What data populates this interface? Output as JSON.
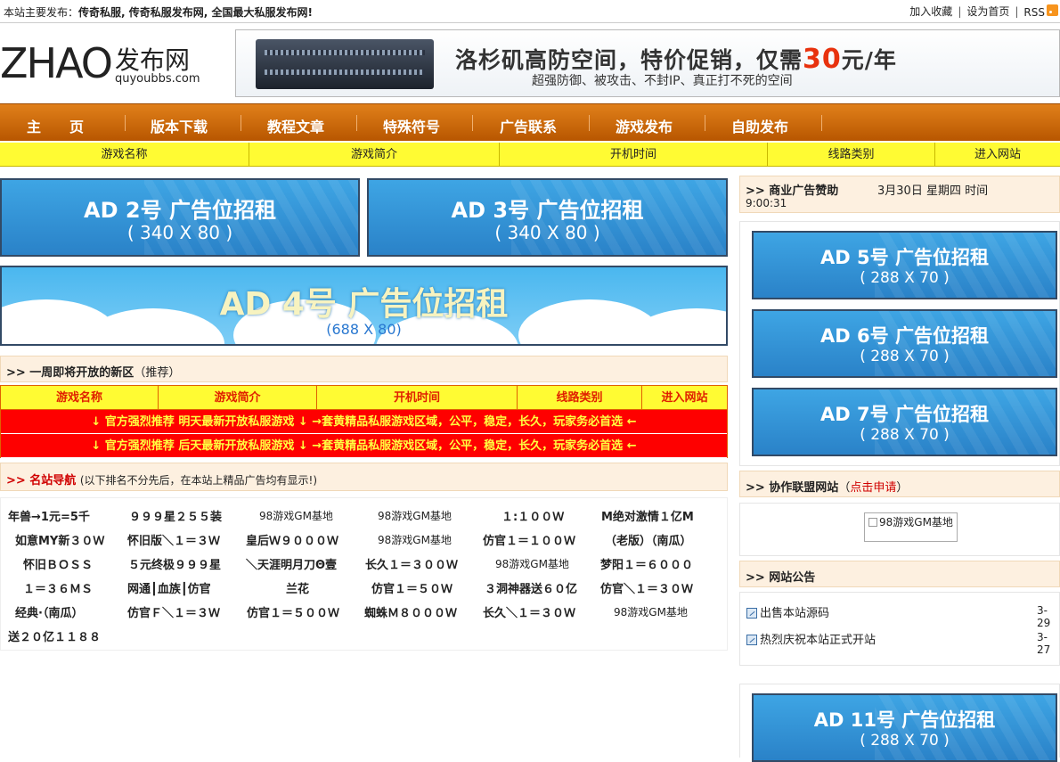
{
  "topbar": {
    "left_prefix": "本站主要发布：",
    "left_text": "传奇私服, 传奇私服发布网, 全国最大私服发布网!",
    "links": [
      "加入收藏",
      "设为首页",
      "RSS"
    ]
  },
  "logo": {
    "big": "ZHAO",
    "cn": "发布网",
    "url": "quyoubbs.com"
  },
  "banner": {
    "line1_a": "洛杉矶高防空间，特价促销，仅需",
    "line1_num": "30",
    "line1_b": "元/年",
    "line2": "超强防御、被攻击、不封IP、真正打不死的空间"
  },
  "nav": [
    "主　　页",
    "版本下载",
    "教程文章",
    "特殊符号",
    "广告联系",
    "游戏发布",
    "自助发布"
  ],
  "subnav": [
    "游戏名称",
    "游戏简介",
    "开机时间",
    "线路类别",
    "进入网站"
  ],
  "ads": {
    "ad2": {
      "l1": "AD 2号 广告位招租",
      "l2": "( 340 X 80 )"
    },
    "ad3": {
      "l1": "AD 3号 广告位招租",
      "l2": "( 340 X 80 )"
    },
    "ad4": {
      "l1": "AD 4号 广告位招租",
      "l2": "(688 X 80)"
    },
    "ad5": {
      "l1": "AD 5号 广告位招租",
      "l2": "( 288 X 70 )"
    },
    "ad6": {
      "l1": "AD 6号 广告位招租",
      "l2": "( 288 X 70 )"
    },
    "ad7": {
      "l1": "AD 7号 广告位招租",
      "l2": "( 288 X 70 )"
    },
    "ad11": {
      "l1": "AD 11号 广告位招租",
      "l2": "( 288 X 70 )"
    }
  },
  "week_section": {
    "title": ">> 一周即将开放的新区",
    "suffix": "（推荐）"
  },
  "table": {
    "headers": [
      "游戏名称",
      "游戏简介",
      "开机时间",
      "线路类别",
      "进入网站"
    ],
    "row1": "↓ 官方强烈推荐 明天最新开放私服游戏 ↓ →套黄精品私服游戏区域，公平，稳定，长久，玩家务必首选 ←",
    "row2": "↓ 官方强烈推荐 后天最新开放私服游戏 ↓ →套黄精品私服游戏区域，公平，稳定，长久，玩家务必首选 ←"
  },
  "sites_section": {
    "title": ">> 名站导航",
    "note": "(以下排名不分先后，在本站上精品广告均有显示!)"
  },
  "sites": [
    [
      "年兽→1元=5千",
      "９９９星２５５装",
      "98游戏GM基地",
      "98游戏GM基地",
      "１:１００Ｗ",
      "M绝对激情１亿M"
    ],
    [
      "如意MY新３０Ｗ",
      "怀旧版＼１＝３Ｗ",
      "皇后Ｗ９０００Ｗ",
      "98游戏GM基地",
      "仿官１＝１００Ｗ",
      "（老版）（南瓜）"
    ],
    [
      "怀旧ＢＯＳＳ",
      "５元终极９９９星",
      "＼天涯明月刀Θ壹",
      "长久１＝３００Ｗ",
      "98游戏GM基地",
      "梦阳１＝６０００"
    ],
    [
      "１＝３６ＭＳ",
      "网通┃血族┃仿官",
      "兰花",
      "仿官１＝５０Ｗ",
      "３洞神器送６０亿",
      "仿官＼１＝３０Ｗ"
    ],
    [
      "经典·（南瓜）",
      "仿官Ｆ＼１＝３Ｗ",
      "仿官１＝５００Ｗ",
      "蜘蛛Ｍ８０００Ｗ",
      "长久＼１＝３０Ｗ",
      "98游戏GM基地"
    ],
    [
      "送２０亿１１８８"
    ]
  ],
  "right": {
    "sponsor_title": ">> 商业广告赞助",
    "date_text": "3月30日  星期四  时间",
    "time_text": "9:00:31",
    "partner_title": ">> 协作联盟网站",
    "partner_apply_open": "（",
    "partner_apply": "点击申请",
    "partner_apply_close": "）",
    "partner_img_alt": "98游戏GM基地",
    "notice_title": ">> 网站公告",
    "notices": [
      {
        "text": "出售本站源码",
        "date": "3-29"
      },
      {
        "text": "热烈庆祝本站正式开站",
        "date": "3-27"
      }
    ]
  }
}
